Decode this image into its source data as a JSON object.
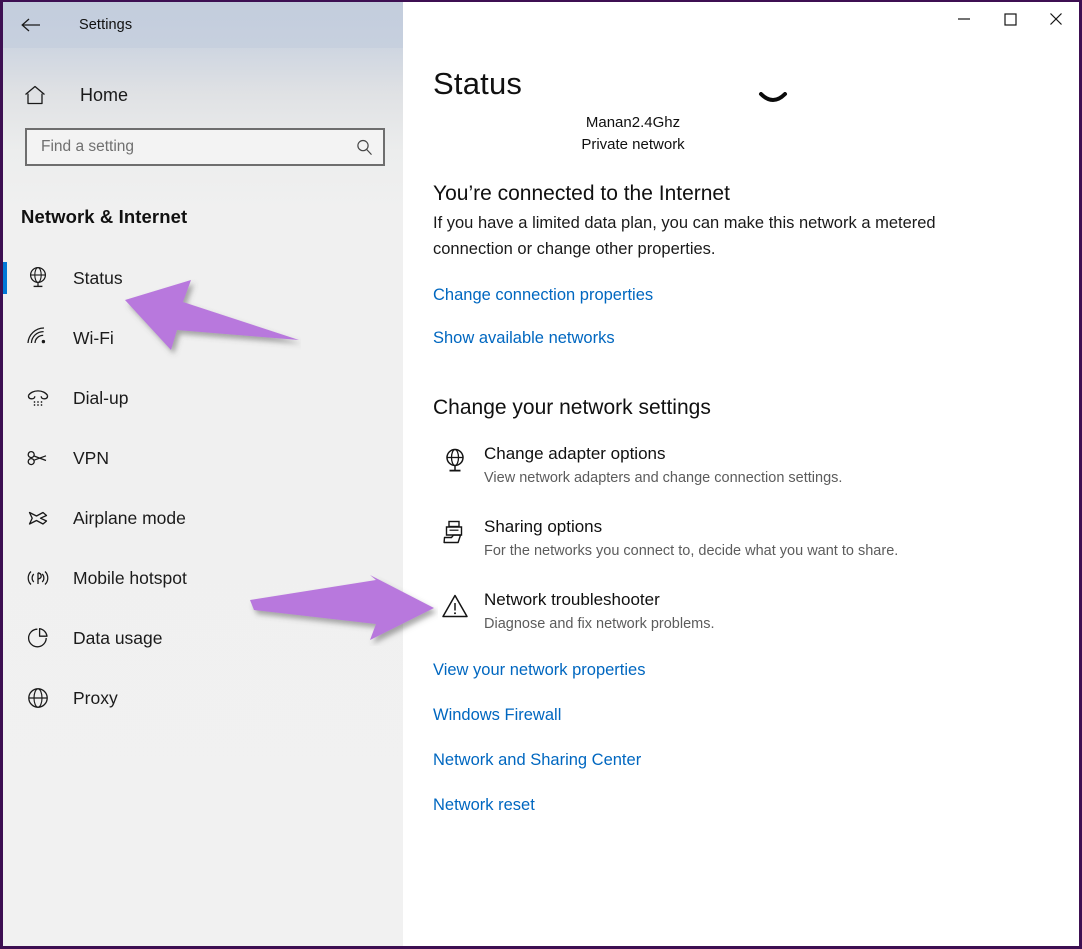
{
  "window": {
    "title": "Settings",
    "back_icon": "back-arrow-icon",
    "minimize_label": "Minimize",
    "maximize_label": "Maximize",
    "close_label": "Close"
  },
  "sidebar": {
    "home": {
      "label": "Home",
      "icon": "home-icon"
    },
    "search": {
      "placeholder": "Find a setting",
      "value": "",
      "icon": "search-icon"
    },
    "category_title": "Network & Internet",
    "items": [
      {
        "label": "Status",
        "icon": "globe-icon",
        "selected": true
      },
      {
        "label": "Wi-Fi",
        "icon": "wifi-icon",
        "selected": false
      },
      {
        "label": "Dial-up",
        "icon": "phone-icon",
        "selected": false
      },
      {
        "label": "VPN",
        "icon": "key-icon",
        "selected": false
      },
      {
        "label": "Airplane mode",
        "icon": "airplane-icon",
        "selected": false
      },
      {
        "label": "Mobile hotspot",
        "icon": "hotspot-icon",
        "selected": false
      },
      {
        "label": "Data usage",
        "icon": "pie-chart-icon",
        "selected": false
      },
      {
        "label": "Proxy",
        "icon": "globe-outline-icon",
        "selected": false
      }
    ]
  },
  "main": {
    "page_title": "Status",
    "network": {
      "name": "Manan2.4Ghz",
      "type": "Private network",
      "icon": "network-status-icon"
    },
    "connection": {
      "heading": "You’re connected to the Internet",
      "description": "If you have a limited data plan, you can make this network a metered connection or change other properties."
    },
    "top_links": [
      {
        "label": "Change connection properties"
      },
      {
        "label": "Show available networks"
      }
    ],
    "settings_section": {
      "heading": "Change your network settings",
      "options": [
        {
          "title": "Change adapter options",
          "subtitle": "View network adapters and change connection settings.",
          "icon": "adapter-icon"
        },
        {
          "title": "Sharing options",
          "subtitle": "For the networks you connect to, decide what you want to share.",
          "icon": "sharing-icon"
        },
        {
          "title": "Network troubleshooter",
          "subtitle": "Diagnose and fix network problems.",
          "icon": "warning-triangle-icon"
        }
      ]
    },
    "bottom_links": [
      {
        "label": "View your network properties"
      },
      {
        "label": "Windows Firewall"
      },
      {
        "label": "Network and Sharing Center"
      },
      {
        "label": "Network reset"
      }
    ]
  },
  "annotations": [
    {
      "name": "arrow-pointing-to-status",
      "direction": "left",
      "color": "#b878dd"
    },
    {
      "name": "arrow-pointing-to-sharing",
      "direction": "right",
      "color": "#b878dd"
    }
  ],
  "colors": {
    "accent": "#0078d7",
    "link": "#0067c0",
    "annotation": "#b878dd",
    "window_border": "#3d0f52"
  }
}
